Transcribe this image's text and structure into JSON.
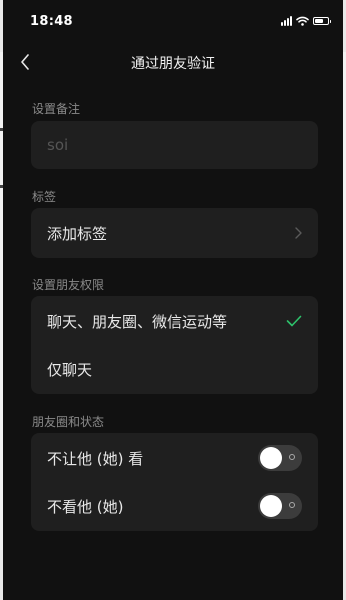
{
  "status_bar": {
    "time": "18:48"
  },
  "nav": {
    "title": "通过朋友验证"
  },
  "remark": {
    "label": "设置备注",
    "value": "soi"
  },
  "tags": {
    "label": "标签",
    "add_label": "添加标签"
  },
  "permissions": {
    "label": "设置朋友权限",
    "options": [
      {
        "label": "聊天、朋友圈、微信运动等",
        "selected": true
      },
      {
        "label": "仅聊天",
        "selected": false
      }
    ]
  },
  "moments": {
    "label": "朋友圈和状态",
    "items": [
      {
        "label": "不让他 (她) 看",
        "on": false
      },
      {
        "label": "不看他 (她)",
        "on": false
      }
    ]
  },
  "colors": {
    "checkmark": "#2dc26b",
    "card": "#1f1f1f",
    "background": "#111111"
  }
}
